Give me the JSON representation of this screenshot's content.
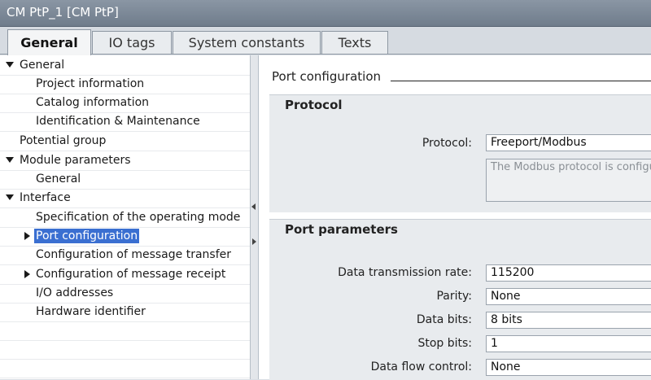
{
  "window": {
    "title": "CM PtP_1 [CM PtP]"
  },
  "tabs": [
    {
      "label": "General",
      "active": true
    },
    {
      "label": "IO tags",
      "active": false
    },
    {
      "label": "System constants",
      "active": false
    },
    {
      "label": "Texts",
      "active": false
    }
  ],
  "tree": {
    "items": [
      {
        "label": "General",
        "expand": "down"
      },
      {
        "label": "Project information"
      },
      {
        "label": "Catalog information"
      },
      {
        "label": "Identification & Maintenance"
      },
      {
        "label": "Potential group"
      },
      {
        "label": "Module parameters",
        "expand": "down"
      },
      {
        "label": "General"
      },
      {
        "label": "Interface",
        "expand": "down"
      },
      {
        "label": "Specification of the operating mode"
      },
      {
        "label": "Port configuration",
        "expand": "right",
        "selected": true
      },
      {
        "label": "Configuration of message transfer"
      },
      {
        "label": "Configuration of message receipt",
        "expand": "right"
      },
      {
        "label": "I/O addresses"
      },
      {
        "label": "Hardware identifier"
      }
    ]
  },
  "content": {
    "heading": "Port configuration",
    "protocol_section": {
      "title": "Protocol",
      "protocol_label": "Protocol:",
      "protocol_value": "Freeport/Modbus",
      "description": "The Modbus protocol is configu"
    },
    "port_section": {
      "title": "Port parameters",
      "fields": [
        {
          "label": "Data transmission rate:",
          "value": "115200"
        },
        {
          "label": "Parity:",
          "value": "None"
        },
        {
          "label": "Data bits:",
          "value": "8 bits"
        },
        {
          "label": "Stop bits:",
          "value": "1"
        },
        {
          "label": "Data flow control:",
          "value": "None"
        }
      ]
    }
  }
}
